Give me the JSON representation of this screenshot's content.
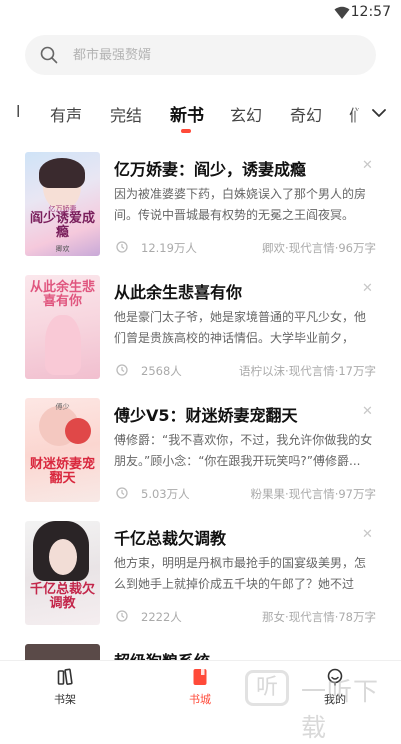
{
  "status_bar": {
    "time": "12:57",
    "wifi_icon": "wifi-icon"
  },
  "search": {
    "placeholder": "都市最强赘婿",
    "icon": "search-icon"
  },
  "tabs": {
    "items": [
      {
        "label": "有声"
      },
      {
        "label": "完结"
      },
      {
        "label": "新书",
        "active": true
      },
      {
        "label": "玄幻"
      },
      {
        "label": "奇幻"
      }
    ],
    "partial_left": "l",
    "partial_right": "们",
    "accent_color": "#ff4a39",
    "expand_icon": "chevron-down-icon"
  },
  "books": [
    {
      "title": "亿万娇妻：阎少，诱妻成瘾",
      "description": "因为被准婆婆下药，白姝娆误入了那个男人的房间。传说中晋城最有权势的无冕之王阎夜冥。第...",
      "readers": "12.19万人",
      "author_meta": "卿欢·现代言情·96万字",
      "cover_text": "阎少诱爱成瘾",
      "cover_sub": "亿万娇妻",
      "cover_author": "卿欢"
    },
    {
      "title": "从此余生悲喜有你",
      "description": "他是豪门太子爷，她是家境普通的平凡少女，他们曾是贵族高校的神话情侣。大学毕业前夕，他...",
      "readers": "2568人",
      "author_meta": "语柠以沫·现代言情·17万字",
      "cover_text": "从此余生悲喜有你"
    },
    {
      "title": "傅少V5：财迷娇妻宠翻天",
      "description": "傅修爵：“我不喜欢你，不过，我允许你做我的女朋友。”顾小念：“你在跟我开玩笑吗?”傅修爵...",
      "readers": "5.03万人",
      "author_meta": "粉果果·现代言情·97万字",
      "cover_text": "财迷娇妻宠翻天",
      "cover_sub": "傅少"
    },
    {
      "title": "千亿总裁欠调教",
      "description": "他方束，明明是丹枫市最抢手的国宴级美男，怎么到她手上就掉价成五千块的午郎了？她不过仗...",
      "readers": "2222人",
      "author_meta": "那女·现代言情·78万字",
      "cover_text": "千亿总裁欠调教"
    },
    {
      "title": "超级狗粮系统"
    }
  ],
  "bottom_nav": [
    {
      "label": "书架",
      "icon": "bookshelf-icon"
    },
    {
      "label": "书城",
      "icon": "bookstore-icon",
      "active": true
    },
    {
      "label": "我的",
      "icon": "profile-icon"
    }
  ],
  "watermark": {
    "text": "一听下载",
    "logo": "听"
  }
}
